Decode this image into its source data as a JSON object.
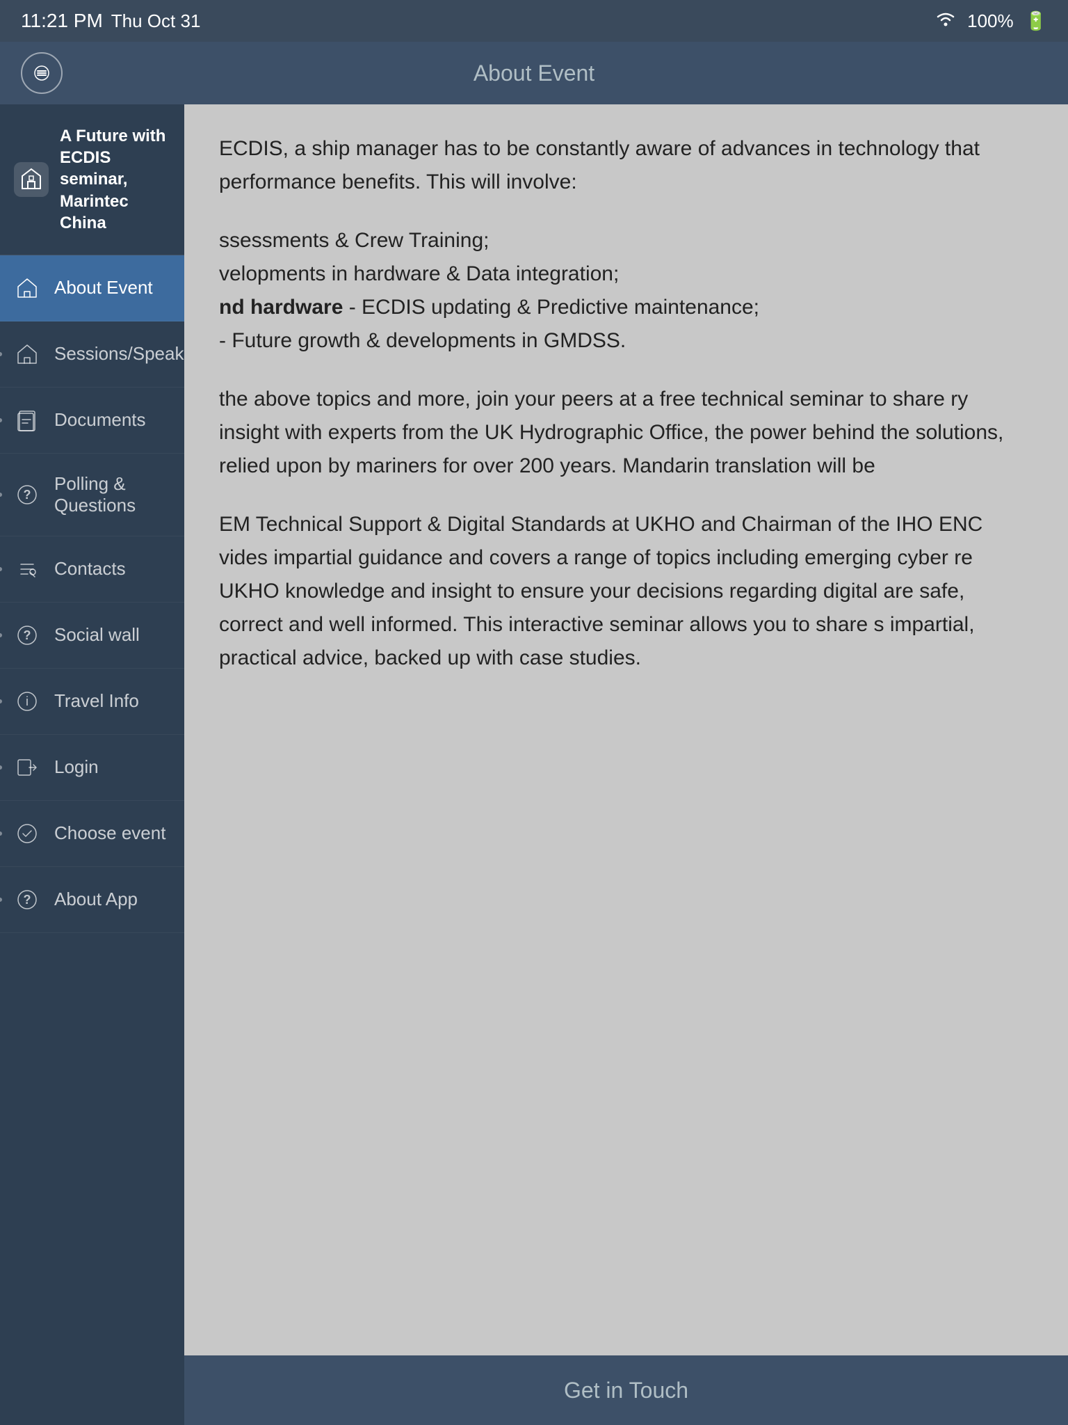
{
  "status_bar": {
    "time": "11:21 PM",
    "date": "Thu Oct 31",
    "wifi": "WiFi",
    "battery": "100%"
  },
  "header": {
    "title": "About Event",
    "menu_label": "Menu"
  },
  "sidebar": {
    "app_title": "A Future with ECDIS seminar, Marintec China",
    "items": [
      {
        "id": "about-event",
        "label": "About Event",
        "icon": "home",
        "active": true
      },
      {
        "id": "sessions-speakers",
        "label": "Sessions/Speakers",
        "icon": "home",
        "active": false
      },
      {
        "id": "documents",
        "label": "Documents",
        "icon": "briefcase",
        "active": false
      },
      {
        "id": "polling-questions",
        "label": "Polling & Questions",
        "icon": "question",
        "active": false
      },
      {
        "id": "contacts",
        "label": "Contacts",
        "icon": "pencil",
        "active": false
      },
      {
        "id": "social-wall",
        "label": "Social wall",
        "icon": "question-circle",
        "active": false
      },
      {
        "id": "travel-info",
        "label": "Travel Info",
        "icon": "info",
        "active": false
      },
      {
        "id": "login",
        "label": "Login",
        "icon": "login",
        "active": false
      },
      {
        "id": "choose-event",
        "label": "Choose event",
        "icon": "check-circle",
        "active": false
      },
      {
        "id": "about-app",
        "label": "About App",
        "icon": "question-circle",
        "active": false
      }
    ]
  },
  "content": {
    "paragraphs": [
      "ECDIS, a ship manager has to be constantly aware of advances in technology that performance benefits.  This will involve:",
      "ssessments & Crew Training;\nvelopments in hardware & Data integration;\nnd hardware - ECDIS updating & Predictive maintenance;\n- Future growth & developments in GMDSS.",
      "the above topics and more, join your peers at a free technical seminar to share ry insight with experts from the UK Hydrographic Office, the power behind the solutions, relied upon by mariners for over 200 years.  Mandarin translation will be",
      "EM Technical Support & Digital Standards at UKHO and Chairman of the IHO ENC vides impartial guidance and covers a range of topics including emerging cyber re UKHO knowledge and insight to ensure your decisions regarding digital are safe, correct and well informed.  This interactive seminar allows you to share s impartial, practical advice, backed up with case studies."
    ]
  },
  "bottom_bar": {
    "button_label": "Get in Touch"
  }
}
